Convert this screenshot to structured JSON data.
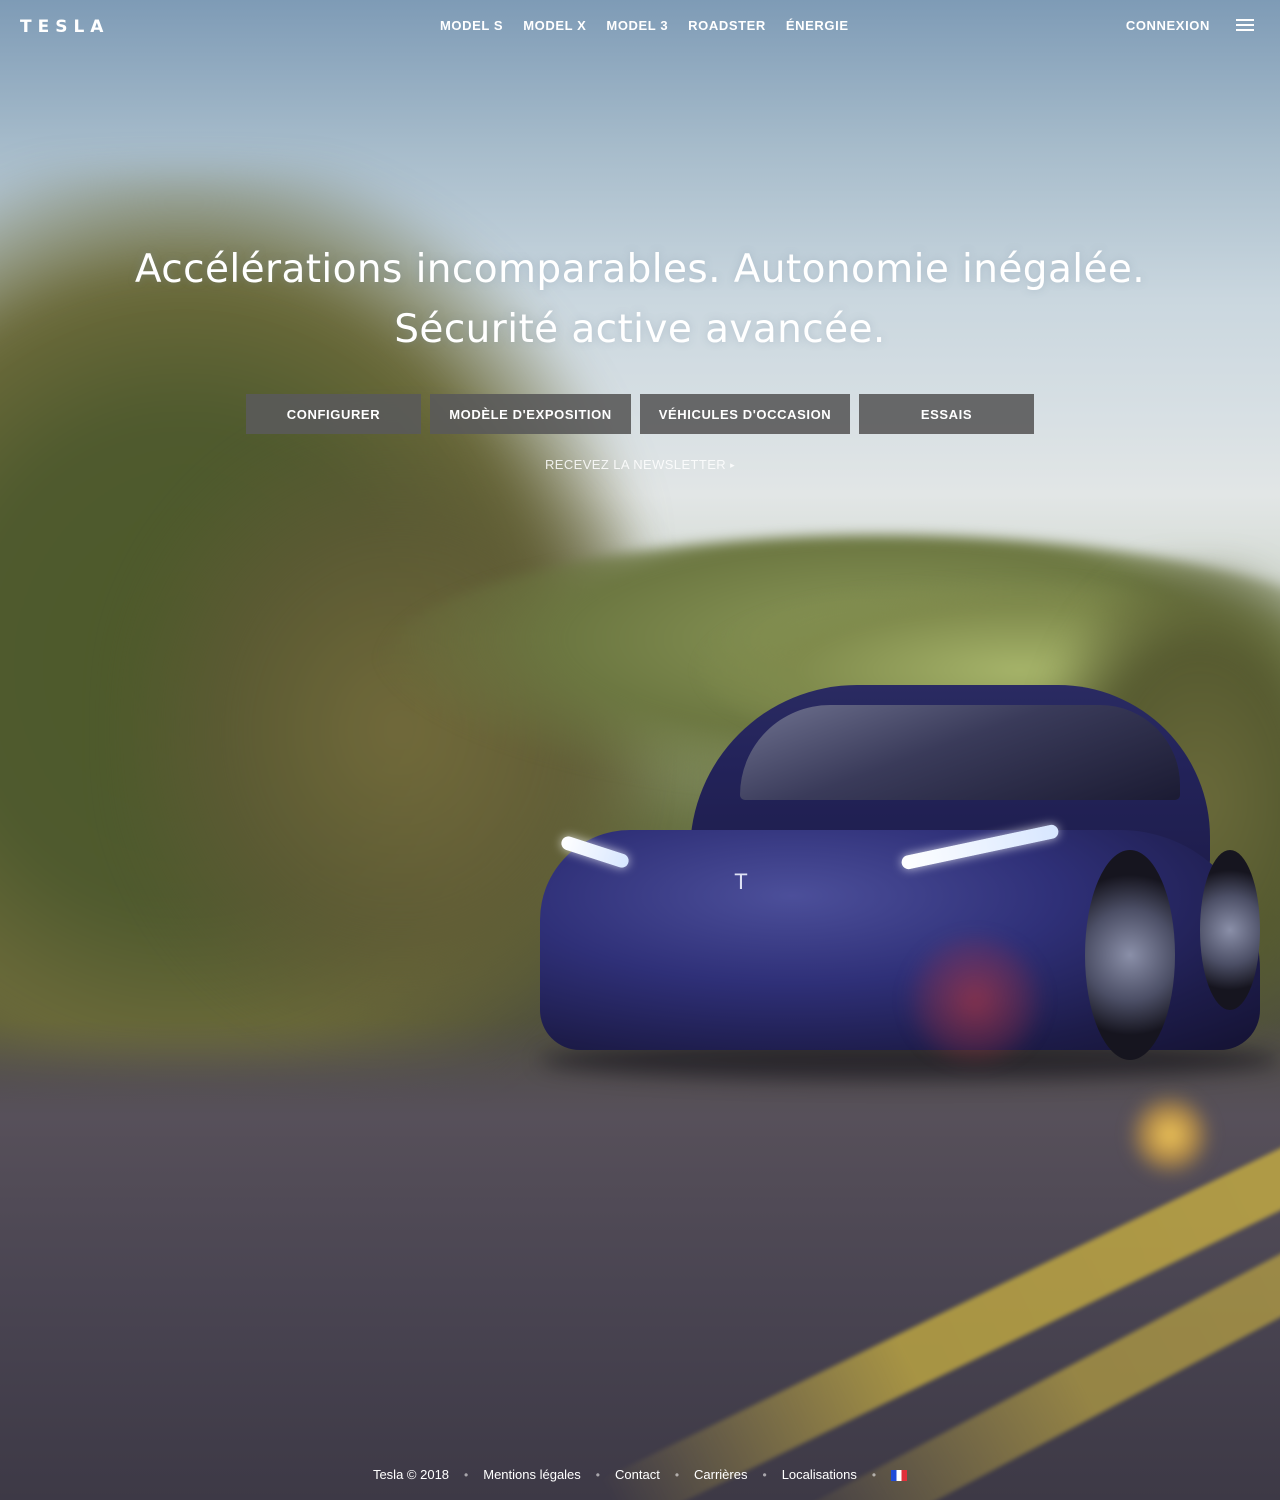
{
  "header": {
    "logo_text": "TESLA",
    "nav": [
      {
        "label": "MODEL S"
      },
      {
        "label": "MODEL X"
      },
      {
        "label": "MODEL 3"
      },
      {
        "label": "ROADSTER"
      },
      {
        "label": "ÉNERGIE"
      }
    ],
    "login_label": "CONNEXION",
    "menu_icon": "hamburger-icon"
  },
  "hero": {
    "title_line_1": "Accélérations incomparables. Autonomie inégalée.",
    "title_line_2": "Sécurité active avancée.",
    "buttons": [
      {
        "label": "CONFIGURER"
      },
      {
        "label": "MODÈLE D'EXPOSITION"
      },
      {
        "label": "VÉHICULES D'OCCASION"
      },
      {
        "label": "ESSAIS"
      }
    ],
    "newsletter_label": "RECEVEZ LA NEWSLETTER",
    "newsletter_arrow": "▸",
    "cta_background": "#5a5a5a"
  },
  "footer": {
    "copyright": "Tesla © 2018",
    "links": [
      {
        "label": "Mentions légales"
      },
      {
        "label": "Contact"
      },
      {
        "label": "Carrières"
      },
      {
        "label": "Localisations"
      }
    ],
    "separator": "•",
    "language_icon": "flag-fr-icon"
  }
}
